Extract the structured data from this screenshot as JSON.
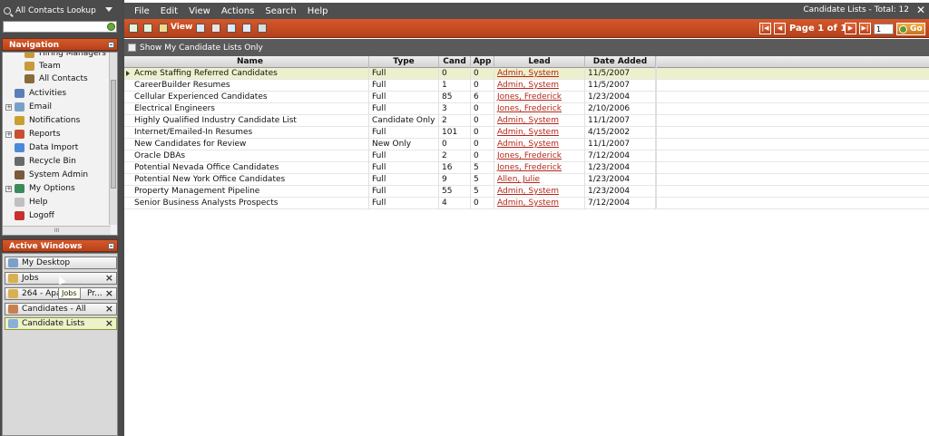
{
  "lookup": {
    "title": "All Contacts Lookup",
    "input_value": ""
  },
  "navigation": {
    "title": "Navigation",
    "items": [
      {
        "label": "Hiring Managers",
        "icon": "hiring-managers-icon"
      },
      {
        "label": "Team",
        "icon": "team-icon"
      },
      {
        "label": "All Contacts",
        "icon": "all-contacts-icon"
      },
      {
        "label": "Activities",
        "icon": "activities-icon"
      },
      {
        "label": "Email",
        "icon": "email-icon",
        "expandable": true
      },
      {
        "label": "Notifications",
        "icon": "notifications-icon"
      },
      {
        "label": "Reports",
        "icon": "reports-icon",
        "expandable": true
      },
      {
        "label": "Data Import",
        "icon": "data-import-icon"
      },
      {
        "label": "Recycle Bin",
        "icon": "recycle-bin-icon"
      },
      {
        "label": "System Admin",
        "icon": "system-admin-icon"
      },
      {
        "label": "My Options",
        "icon": "my-options-icon",
        "expandable": true
      },
      {
        "label": "Help",
        "icon": "help-icon"
      },
      {
        "label": "Logoff",
        "icon": "logoff-icon"
      }
    ],
    "hscroll_grip": "III"
  },
  "active_windows": {
    "title": "Active Windows",
    "items": [
      {
        "label": "My Desktop",
        "closable": false,
        "active": false
      },
      {
        "label": "Jobs",
        "closable": true,
        "active": false
      },
      {
        "label": "264 - Apa",
        "suffix": "Pr...",
        "closable": true,
        "active": false
      },
      {
        "label": "Candidates - All",
        "closable": true,
        "active": false
      },
      {
        "label": "Candidate Lists",
        "closable": true,
        "active": true
      }
    ],
    "tooltip": "Jobs"
  },
  "menu": [
    "File",
    "Edit",
    "View",
    "Actions",
    "Search",
    "Help"
  ],
  "window": {
    "title": "Candidate Lists - Total: 12",
    "close": "✕"
  },
  "toolbar": {
    "view_label": "View",
    "page_label": "Page 1 of 1",
    "page_value": "1",
    "go_label": "Go"
  },
  "filter": {
    "show_mine_label": "Show My Candidate Lists Only"
  },
  "table": {
    "columns": [
      "Name",
      "Type",
      "Cand",
      "App",
      "Lead",
      "Date Added"
    ],
    "rows": [
      [
        "Acme Staffing Referred Candidates",
        "Full",
        "0",
        "0",
        "Admin, System",
        "11/5/2007"
      ],
      [
        "CareerBuilder Resumes",
        "Full",
        "1",
        "0",
        "Admin, System",
        "11/5/2007"
      ],
      [
        "Cellular Experienced Candidates",
        "Full",
        "85",
        "6",
        "Jones, Frederick",
        "1/23/2004"
      ],
      [
        "Electrical Engineers",
        "Full",
        "3",
        "0",
        "Jones, Frederick",
        "2/10/2006"
      ],
      [
        "Highly Qualified Industry Candidate List",
        "Candidate Only",
        "2",
        "0",
        "Admin, System",
        "11/1/2007"
      ],
      [
        "Internet/Emailed-In Resumes",
        "Full",
        "101",
        "0",
        "Admin, System",
        "4/15/2002"
      ],
      [
        "New Candidates for Review",
        "New Only",
        "0",
        "0",
        "Admin, System",
        "11/1/2007"
      ],
      [
        "Oracle DBAs",
        "Full",
        "2",
        "0",
        "Jones, Frederick",
        "7/12/2004"
      ],
      [
        "Potential Nevada Office Candidates",
        "Full",
        "16",
        "5",
        "Jones, Frederick",
        "1/23/2004"
      ],
      [
        "Potential New York Office Candidates",
        "Full",
        "9",
        "5",
        "Allen, Julie",
        "1/23/2004"
      ],
      [
        "Property Management Pipeline",
        "Full",
        "55",
        "5",
        "Admin, System",
        "1/23/2004"
      ],
      [
        "Senior Business Analysts Prospects",
        "Full",
        "4",
        "0",
        "Admin, System",
        "7/12/2004"
      ]
    ]
  },
  "colors": {
    "accent": "#c84a20",
    "panel_bg": "#4b4b4b",
    "lead_link": "#b3271a",
    "selected_row": "#eef0cd"
  }
}
